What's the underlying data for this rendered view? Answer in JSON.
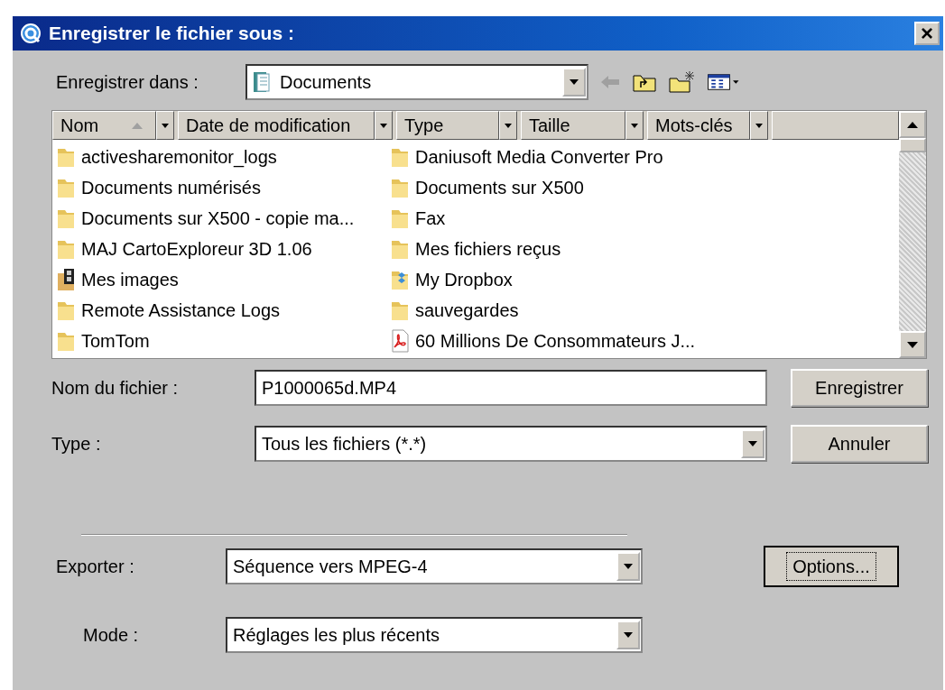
{
  "window": {
    "title": "Enregistrer le fichier sous :",
    "close": "×"
  },
  "save_in": {
    "label": "Enregistrer dans :",
    "value": "Documents"
  },
  "columns": [
    {
      "label": "Nom",
      "sorted": true
    },
    {
      "label": "Date de modification",
      "sorted": false
    },
    {
      "label": "Type",
      "sorted": false
    },
    {
      "label": "Taille",
      "sorted": false
    },
    {
      "label": "Mots-clés",
      "sorted": false
    }
  ],
  "files": [
    {
      "name": "activesharemonitor_logs",
      "kind": "folder"
    },
    {
      "name": "Documents numérisés",
      "kind": "folder"
    },
    {
      "name": "Documents sur X500 - copie ma...",
      "kind": "folder"
    },
    {
      "name": "MAJ CartoExploreur 3D 1.06",
      "kind": "folder"
    },
    {
      "name": "Mes images",
      "kind": "pictures"
    },
    {
      "name": "Remote Assistance Logs",
      "kind": "folder"
    },
    {
      "name": "TomTom",
      "kind": "folder"
    },
    {
      "name": "Daniusoft Media Converter Pro",
      "kind": "folder"
    },
    {
      "name": "Documents sur X500",
      "kind": "folder"
    },
    {
      "name": "Fax",
      "kind": "folder"
    },
    {
      "name": "Mes fichiers reçus",
      "kind": "folder"
    },
    {
      "name": "My Dropbox",
      "kind": "dropbox"
    },
    {
      "name": "sauvegardes",
      "kind": "folder"
    },
    {
      "name": "60 Millions De Consommateurs J...",
      "kind": "pdf"
    }
  ],
  "filename": {
    "label": "Nom du fichier :",
    "value": "P1000065d.MP4"
  },
  "type": {
    "label": "Type :",
    "value": "Tous les fichiers (*.*)"
  },
  "export": {
    "label": "Exporter :",
    "value": "Séquence vers MPEG-4"
  },
  "mode": {
    "label": "Mode :",
    "value": "Réglages les plus récents"
  },
  "buttons": {
    "save": "Enregistrer",
    "cancel": "Annuler",
    "options": "Options..."
  }
}
